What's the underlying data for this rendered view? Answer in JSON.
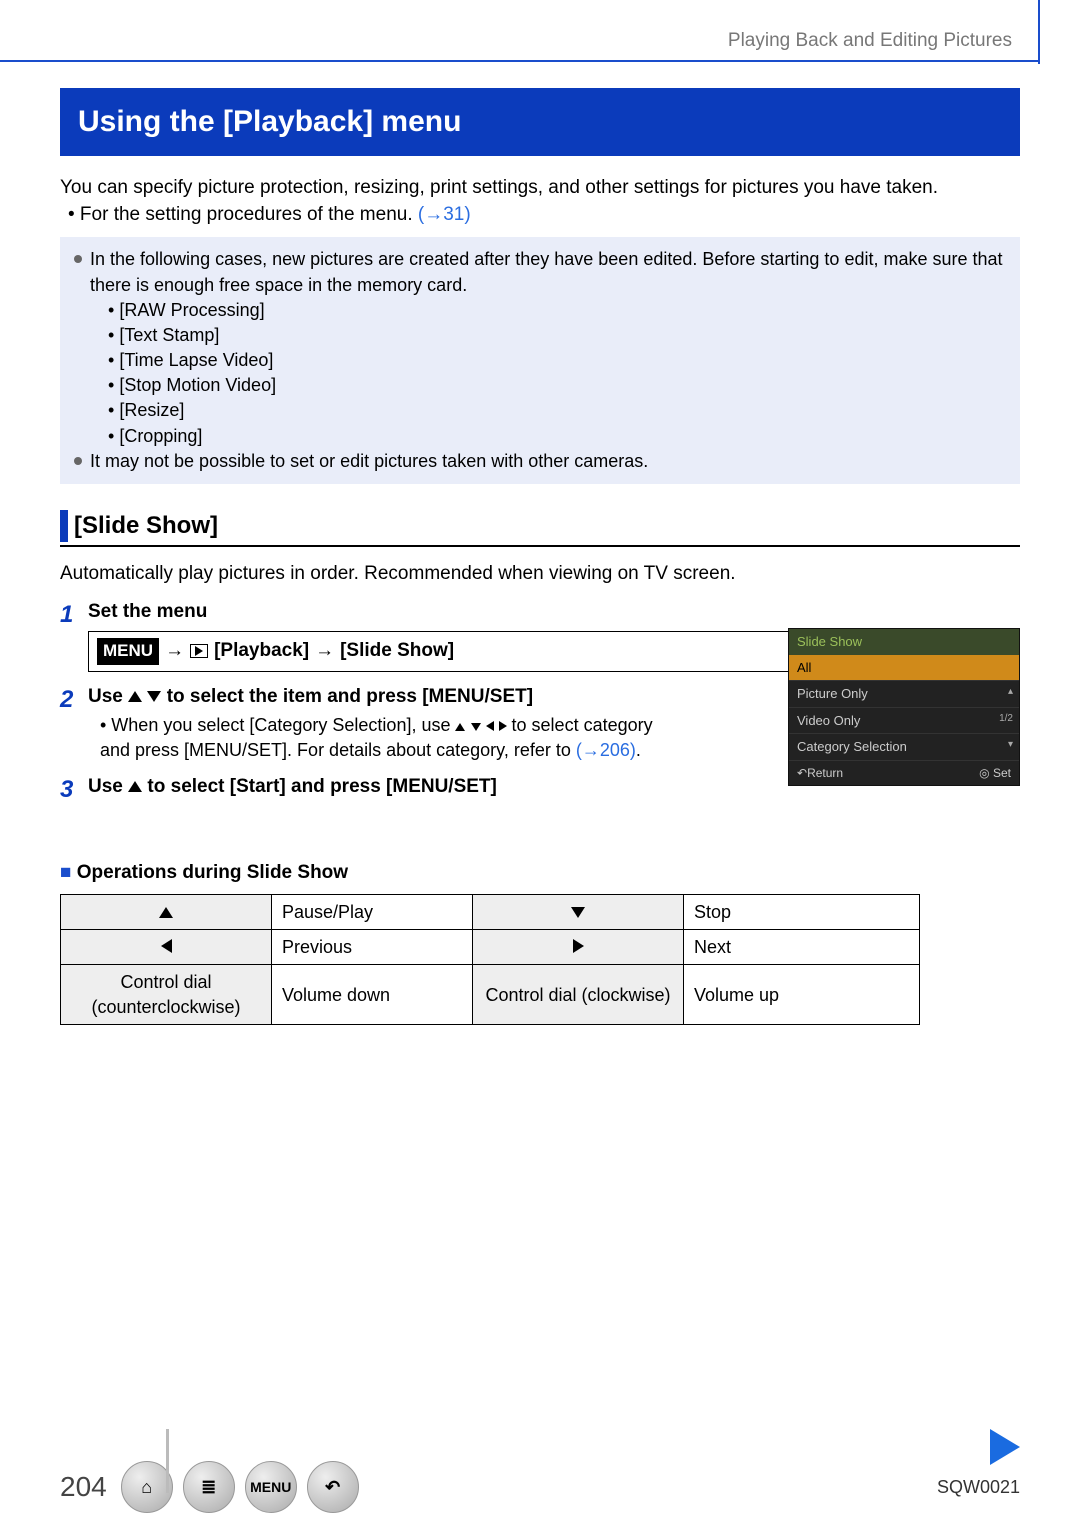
{
  "header": {
    "section_label": "Playing Back and Editing Pictures"
  },
  "title": "Using the [Playback] menu",
  "intro": {
    "text": "You can specify picture protection, resizing, print settings, and other settings for pictures you have taken.",
    "bullet_prefix": " • For the setting procedures of the menu. ",
    "bullet_link": "(→31)"
  },
  "notes": {
    "line1": "In the following cases, new pictures are created after they have been edited. Before starting to edit, make sure that there is enough free space in the memory card.",
    "items": [
      "[RAW Processing]",
      "[Text Stamp]",
      "[Time Lapse Video]",
      "[Stop Motion Video]",
      "[Resize]",
      "[Cropping]"
    ],
    "line2": "It may not be possible to set or edit pictures taken with other cameras."
  },
  "sub": {
    "heading": "[Slide Show]",
    "desc": "Automatically play pictures in order. Recommended when viewing on TV screen."
  },
  "steps": {
    "s1": {
      "title": "Set the menu",
      "menu_label": "MENU",
      "path1": "[Playback]",
      "path2": "[Slide Show]"
    },
    "s2": {
      "title_a": "Use ",
      "title_b": " to select the item and press [MENU/SET]",
      "sub_a": "• When you select [Category Selection], use ",
      "sub_b": " to select category and press [MENU/SET]. For details about category, refer to ",
      "sub_link": "(→206)",
      "sub_c": "."
    },
    "s3": {
      "title_a": "Use ",
      "title_b": " to select [Start] and press [MENU/SET]"
    }
  },
  "screenshot": {
    "head": "Slide Show",
    "items": [
      "All",
      "Picture Only",
      "Video Only",
      "Category Selection"
    ],
    "page": "1/2",
    "return": "Return",
    "set": "Set"
  },
  "ops": {
    "heading": "Operations during Slide Show",
    "rows": [
      {
        "l1": "▲",
        "l2": "Pause/Play",
        "r1": "▼",
        "r2": "Stop"
      },
      {
        "l1": "◄",
        "l2": "Previous",
        "r1": "►",
        "r2": "Next"
      },
      {
        "l1": "Control dial (counterclockwise)",
        "l2": "Volume down",
        "r1": "Control dial (clockwise)",
        "r2": "Volume up"
      }
    ]
  },
  "footer": {
    "page": "204",
    "doc_id": "SQW0021",
    "menu": "MENU"
  }
}
